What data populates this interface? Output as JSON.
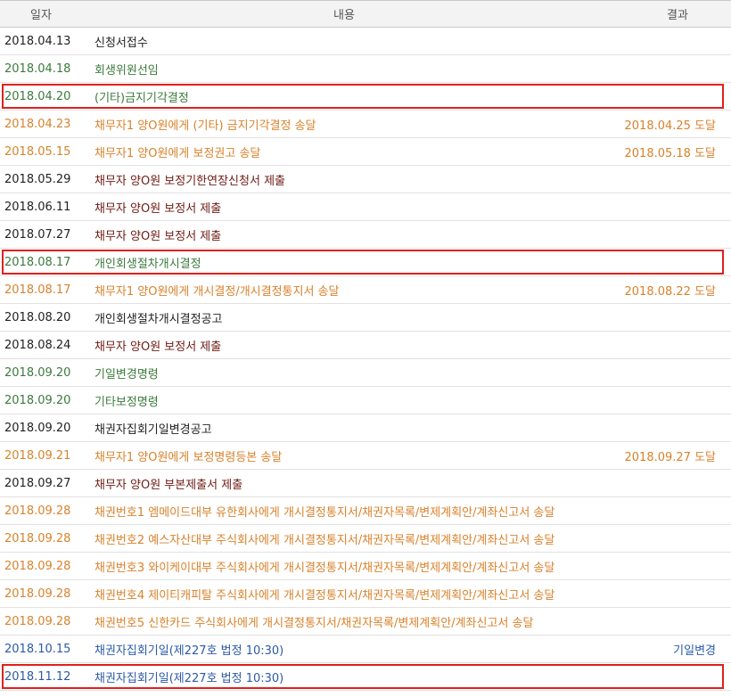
{
  "header": {
    "date_label": "일자",
    "content_label": "내용",
    "result_label": "결과"
  },
  "colors": {
    "black": "#222222",
    "green": "#3c7a3c",
    "orange": "#d9822b",
    "brown": "#6e1a14",
    "blue": "#2a5aa8",
    "highlight": "#e0201b"
  },
  "rows": [
    {
      "date": "2018.04.13",
      "content": "신청서접수",
      "result": "",
      "date_color": "black",
      "content_color": "black",
      "highlight": false
    },
    {
      "date": "2018.04.18",
      "content": "회생위원선임",
      "result": "",
      "date_color": "green",
      "content_color": "green",
      "highlight": false
    },
    {
      "date": "2018.04.20",
      "content": "(기타)금지기각결정",
      "result": "",
      "date_color": "green",
      "content_color": "green",
      "highlight": true
    },
    {
      "date": "2018.04.23",
      "content": "채무자1 양O원에게 (기타) 금지기각결정 송달",
      "result": "2018.04.25 도달",
      "date_color": "orange",
      "content_color": "orange",
      "highlight": false
    },
    {
      "date": "2018.05.15",
      "content": "채무자1 양O원에게 보정권고 송달",
      "result": "2018.05.18 도달",
      "date_color": "orange",
      "content_color": "orange",
      "highlight": false
    },
    {
      "date": "2018.05.29",
      "content": "채무자 양O원 보정기한연장신청서 제출",
      "result": "",
      "date_color": "black",
      "content_color": "brown",
      "highlight": false
    },
    {
      "date": "2018.06.11",
      "content": "채무자 양O원 보정서 제출",
      "result": "",
      "date_color": "black",
      "content_color": "brown",
      "highlight": false
    },
    {
      "date": "2018.07.27",
      "content": "채무자 양O원 보정서 제출",
      "result": "",
      "date_color": "black",
      "content_color": "brown",
      "highlight": false
    },
    {
      "date": "2018.08.17",
      "content": "개인회생절차개시결정",
      "result": "",
      "date_color": "green",
      "content_color": "green",
      "highlight": true
    },
    {
      "date": "2018.08.17",
      "content": "채무자1 양O원에게 개시결정/개시결정통지서 송달",
      "result": "2018.08.22 도달",
      "date_color": "orange",
      "content_color": "orange",
      "highlight": false
    },
    {
      "date": "2018.08.20",
      "content": "개인회생절차개시결정공고",
      "result": "",
      "date_color": "black",
      "content_color": "black",
      "highlight": false
    },
    {
      "date": "2018.08.24",
      "content": "채무자 양O원 보정서 제출",
      "result": "",
      "date_color": "black",
      "content_color": "brown",
      "highlight": false
    },
    {
      "date": "2018.09.20",
      "content": "기일변경명령",
      "result": "",
      "date_color": "green",
      "content_color": "green",
      "highlight": false
    },
    {
      "date": "2018.09.20",
      "content": "기타보정명령",
      "result": "",
      "date_color": "green",
      "content_color": "green",
      "highlight": false
    },
    {
      "date": "2018.09.20",
      "content": "채권자집회기일변경공고",
      "result": "",
      "date_color": "black",
      "content_color": "black",
      "highlight": false
    },
    {
      "date": "2018.09.21",
      "content": "채무자1 양O원에게 보정명령등본 송달",
      "result": "2018.09.27 도달",
      "date_color": "orange",
      "content_color": "orange",
      "highlight": false
    },
    {
      "date": "2018.09.27",
      "content": "채무자 양O원 부본제출서 제출",
      "result": "",
      "date_color": "black",
      "content_color": "brown",
      "highlight": false
    },
    {
      "date": "2018.09.28",
      "content": "채권번호1 엠메이드대부 유한회사에게 개시결정통지서/채권자목록/변제계획안/계좌신고서 송달",
      "result": "",
      "date_color": "orange",
      "content_color": "orange",
      "highlight": false
    },
    {
      "date": "2018.09.28",
      "content": "채권번호2 예스자산대부 주식회사에게 개시결정통지서/채권자목록/변제계획안/계좌신고서 송달",
      "result": "",
      "date_color": "orange",
      "content_color": "orange",
      "highlight": false
    },
    {
      "date": "2018.09.28",
      "content": "채권번호3 와이케이대부 주식회사에게 개시결정통지서/채권자목록/변제계획안/계좌신고서 송달",
      "result": "",
      "date_color": "orange",
      "content_color": "orange",
      "highlight": false
    },
    {
      "date": "2018.09.28",
      "content": "채권번호4 제이티캐피탈 주식회사에게 개시결정통지서/채권자목록/변제계획안/계좌신고서 송달",
      "result": "",
      "date_color": "orange",
      "content_color": "orange",
      "highlight": false
    },
    {
      "date": "2018.09.28",
      "content": "채권번호5 신한카드 주식회사에게 개시결정통지서/채권자목록/변제계획안/계좌신고서 송달",
      "result": "",
      "date_color": "orange",
      "content_color": "orange",
      "highlight": false
    },
    {
      "date": "2018.10.15",
      "content": "채권자집회기일(제227호 법정 10:30)",
      "result": "기일변경",
      "date_color": "blue",
      "content_color": "blue",
      "highlight": false
    },
    {
      "date": "2018.11.12",
      "content": "채권자집회기일(제227호 법정 10:30)",
      "result": "",
      "date_color": "blue",
      "content_color": "blue",
      "highlight": true
    }
  ]
}
